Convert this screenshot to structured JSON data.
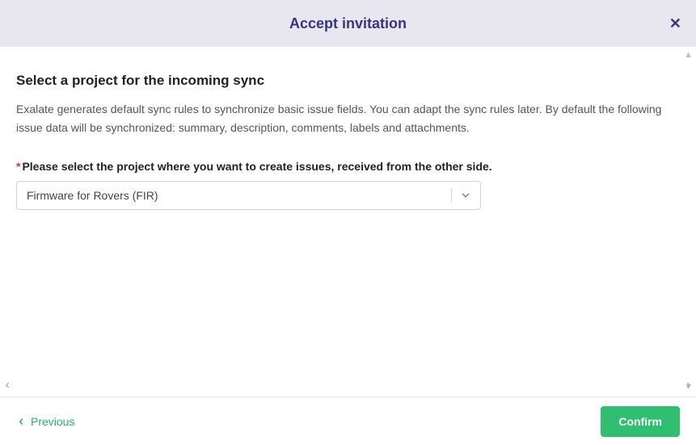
{
  "header": {
    "title": "Accept invitation"
  },
  "main": {
    "section_title": "Select a project for the incoming sync",
    "section_desc": "Exalate generates default sync rules to synchronize basic issue fields. You can adapt the sync rules later. By default the following issue data will be synchronized: summary, description, comments, labels and attachments.",
    "field_label": "Please select the project where you want to create issues, received from the other side.",
    "select_value": "Firmware for Rovers (FIR)"
  },
  "footer": {
    "previous_label": "Previous",
    "confirm_label": "Confirm"
  }
}
